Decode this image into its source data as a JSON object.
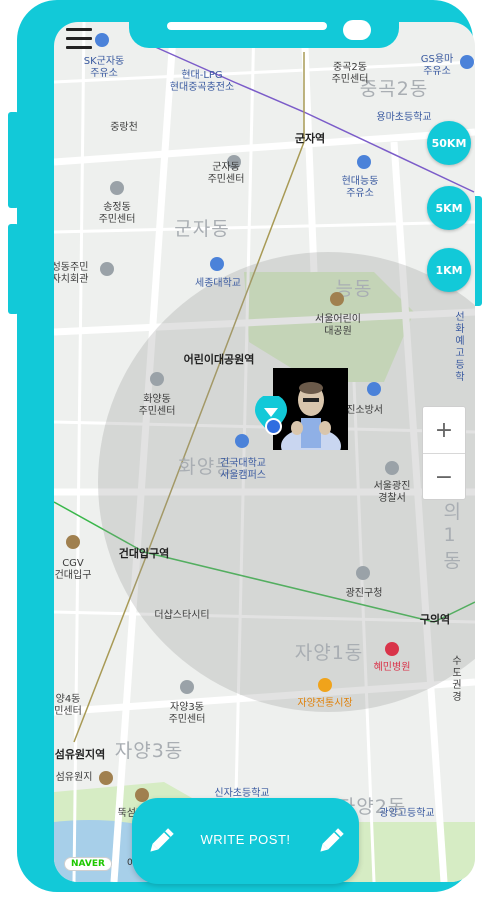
{
  "map": {
    "labels": {
      "sk": "SK군자동\n주유소",
      "lpg": "현대-LPG\n현대중곡충전소",
      "junggok2_center": "중곡2동\n주민센터",
      "gs": "GS용마\n주유소",
      "yongma_school": "용마초등학교",
      "junggokcheon": "중랑천",
      "gunja_station": "군자역",
      "gunja_center": "군자동\n주민센터",
      "neungdong_gas": "현대능동\n주유소",
      "songjeong_center": "송정동\n주민센터",
      "seongdong_jumin": "성동주민\n자치회관",
      "sejong_univ": "세종대학교",
      "childrens_park": "서울어린이\n대공원",
      "seonhwa_school": "선화예\n고등학",
      "children_park_station": "어린이대공원역",
      "hwayang_center": "화양동\n주민센터",
      "gwangjin_fire": "광진소방서",
      "konkuk_univ": "건국대학교\n서울캠퍼스",
      "gwangjin_police": "서울광진\n경찰서",
      "cgv": "CGV\n건대입구",
      "konkuk_station": "건대입구역",
      "gwangjin_gu": "광진구청",
      "common_city": "더샵스타시티",
      "guui_station": "구의역",
      "hyemin_hospital": "혜민병원",
      "sudo_gwan": "수도권경",
      "jayang4": "양4동\n민센터",
      "jayang3_center": "자양3동\n주민센터",
      "jayang_market": "자양전통시장",
      "ttukseom_station": "섬유원지역",
      "ttukseom_park": "섬유원지",
      "ttukseom_hangang": "뚝섬한강",
      "sinja_school": "신자초등학교",
      "gwangyang_school": "광양고등학교"
    },
    "districts": {
      "junggok2": "중곡2동",
      "gunja": "군자동",
      "neung": "능동",
      "hwayang": "화양동",
      "guui1": "의1동",
      "jayang1": "자양1동",
      "jayang3": "자양3동",
      "jayang2": "자양2동"
    }
  },
  "controls": {
    "km_buttons": [
      "50KM",
      "5KM",
      "1KM"
    ],
    "zoom_in": "+",
    "zoom_out": "−"
  },
  "footer": {
    "naver_badge": "NAVER",
    "scale_label": "0",
    "write_post_label": "WRITE POST!"
  },
  "colors": {
    "accent": "#12c9d8",
    "location": "#2f6ee0"
  }
}
